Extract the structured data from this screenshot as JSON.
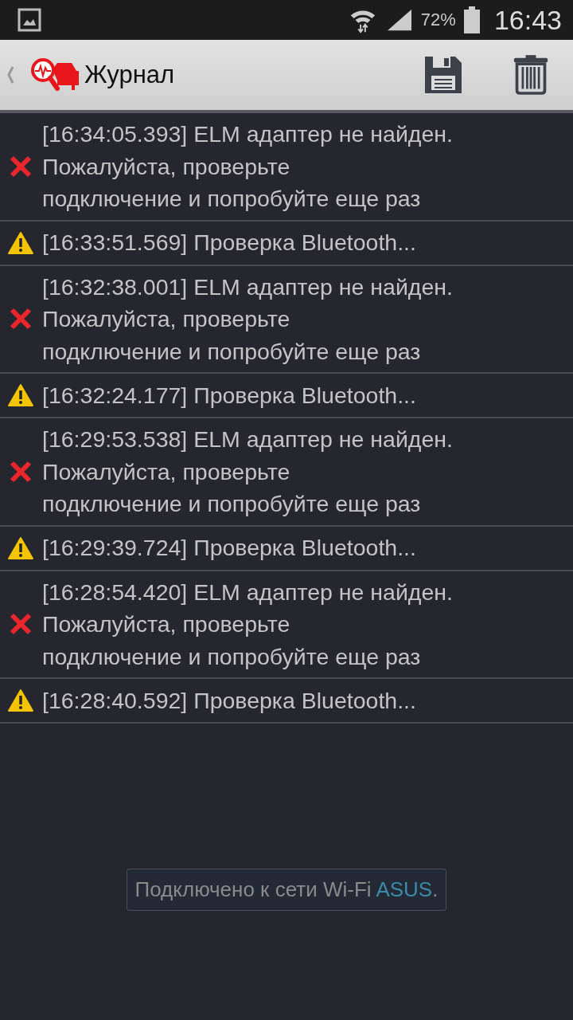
{
  "status_bar": {
    "battery": "72%",
    "time": "16:43"
  },
  "action_bar": {
    "title": "Журнал"
  },
  "log": [
    {
      "kind": "error",
      "lines": [
        "[16:34:05.393] ELM адаптер не найден.",
        "Пожалуйста, проверьте",
        "подключение и попробуйте еще раз"
      ]
    },
    {
      "kind": "warning",
      "lines": [
        "[16:33:51.569] Проверка Bluetooth..."
      ]
    },
    {
      "kind": "error",
      "lines": [
        "[16:32:38.001] ELM адаптер не найден.",
        "Пожалуйста, проверьте",
        "подключение и попробуйте еще раз"
      ]
    },
    {
      "kind": "warning",
      "lines": [
        "[16:32:24.177] Проверка Bluetooth..."
      ]
    },
    {
      "kind": "error",
      "lines": [
        "[16:29:53.538] ELM адаптер не найден.",
        "Пожалуйста, проверьте",
        "подключение и попробуйте еще раз"
      ]
    },
    {
      "kind": "warning",
      "lines": [
        "[16:29:39.724] Проверка Bluetooth..."
      ]
    },
    {
      "kind": "error",
      "lines": [
        "[16:28:54.420] ELM адаптер не найден.",
        "Пожалуйста, проверьте",
        "подключение и попробуйте еще раз"
      ]
    },
    {
      "kind": "warning",
      "lines": [
        "[16:28:40.592] Проверка Bluetooth..."
      ]
    }
  ],
  "toast": {
    "text": "Подключено к сети Wi-Fi ",
    "network": "ASUS",
    "end": "."
  }
}
